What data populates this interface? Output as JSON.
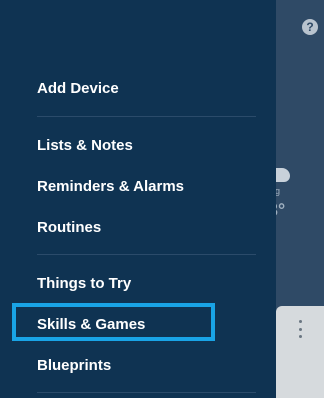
{
  "menu": {
    "add_device": "Add Device",
    "lists_notes": "Lists & Notes",
    "reminders_alarms": "Reminders & Alarms",
    "routines": "Routines",
    "things_to_try": "Things to Try",
    "skills_games": "Skills & Games",
    "blueprints": "Blueprints"
  },
  "background": {
    "help_glyph": "?",
    "weather_text": "ing",
    "weather_temp": "3°"
  },
  "icons": {
    "help": "question-mark-icon",
    "more": "vertical-dots-icon",
    "weather": "cloud-icon"
  },
  "colors": {
    "drawer": "#0f3352",
    "highlight": "#19a4e6",
    "text": "#ffffff"
  }
}
